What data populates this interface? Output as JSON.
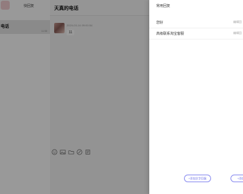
{
  "left_panel": {
    "tab_quick_reply": "快回复",
    "contact_name": "电话",
    "contact_sub": "11:58"
  },
  "chat": {
    "title": "天真的电话",
    "message": {
      "meta": "2024-03-14 09:00:54",
      "text": "11"
    },
    "toolbar_icons": [
      "emoji-icon",
      "image-icon",
      "folder-icon",
      "link-icon",
      "document-icon"
    ]
  },
  "drawer": {
    "title": "常用回复",
    "items": [
      {
        "text": "您好",
        "edit": "编辑回"
      },
      {
        "text": "高级联系淘宝客服",
        "edit": "编辑回"
      }
    ],
    "add_text_button": "+添加文字回复",
    "add_other_button": "+添加"
  },
  "colors": {
    "accent": "#6b6ee6",
    "overlay": "rgba(0,0,0,0.40)"
  }
}
